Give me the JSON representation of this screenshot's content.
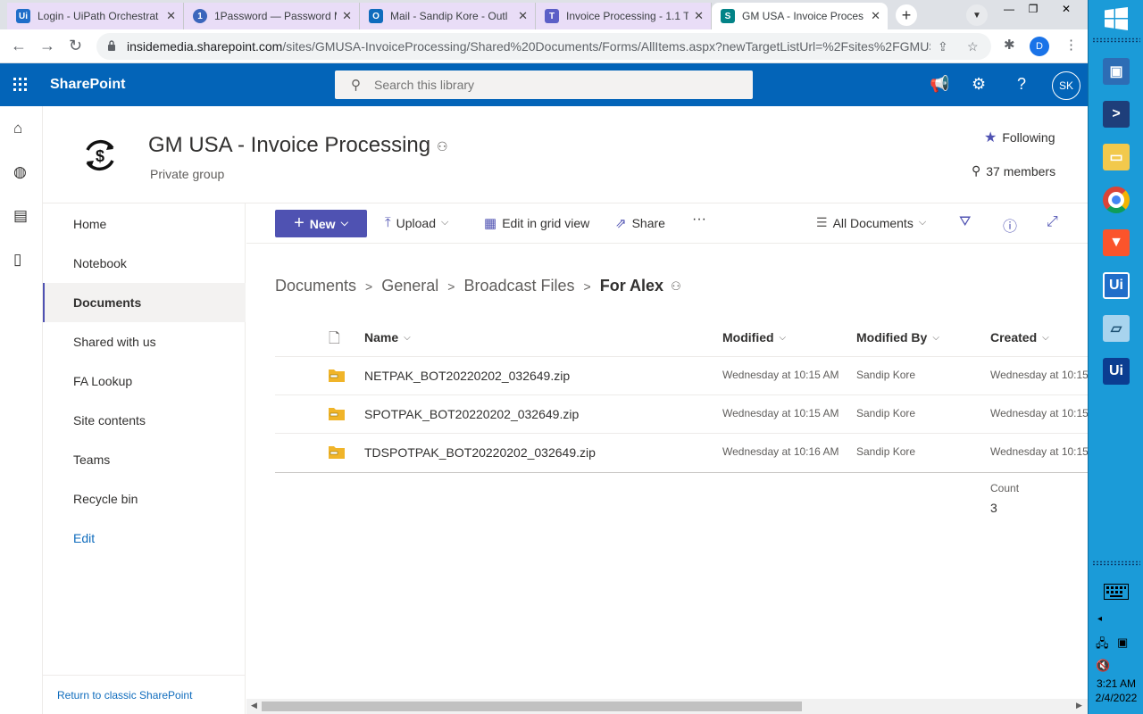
{
  "browser": {
    "tabs": [
      {
        "title": "Login - UiPath Orchestrat",
        "favicon": "Ui",
        "favicon_color": "#1f6ec9"
      },
      {
        "title": "1Password — Password M",
        "favicon": "1",
        "favicon_color": "#3b66bc"
      },
      {
        "title": "Mail - Sandip Kore - Outl",
        "favicon": "O",
        "favicon_color": "#0f6cbd"
      },
      {
        "title": "Invoice Processing - 1.1 T",
        "favicon": "T",
        "favicon_color": "#5b5fc7"
      },
      {
        "title": "GM USA - Invoice Proces",
        "favicon": "S",
        "favicon_color": "#038387"
      }
    ],
    "url_domain": "insidemedia.sharepoint.com",
    "url_rest": "/sites/GMUSA-InvoiceProcessing/Shared%20Documents/Forms/AllItems.aspx?newTargetListUrl=%2Fsites%2FGMUS...",
    "profile_initial": "D"
  },
  "suite": {
    "brand": "SharePoint",
    "search_placeholder": "Search this library",
    "avatar": "SK",
    "bar_color": "#0364b8"
  },
  "site": {
    "title": "GM USA - Invoice Processing",
    "privacy": "Private group",
    "following": "Following",
    "members": "37 members"
  },
  "nav": {
    "items": [
      "Home",
      "Notebook",
      "Documents",
      "Shared with us",
      "FA Lookup",
      "Site contents",
      "Teams",
      "Recycle bin"
    ],
    "selected": "Documents",
    "edit": "Edit",
    "classic": "Return to classic SharePoint"
  },
  "commands": {
    "new": "New",
    "upload": "Upload",
    "grid": "Edit in grid view",
    "share": "Share",
    "more": "···",
    "view": "All Documents",
    "accent": "#4f52b2"
  },
  "breadcrumb": [
    "Documents",
    "General",
    "Broadcast Files",
    "For Alex"
  ],
  "table": {
    "columns": [
      "Name",
      "Modified",
      "Modified By",
      "Created"
    ],
    "rows": [
      {
        "name": "NETPAK_BOT20220202_032649.zip",
        "modified": "Wednesday at 10:15 AM",
        "modified_by": "Sandip Kore",
        "created": "Wednesday at 10:15"
      },
      {
        "name": "SPOTPAK_BOT20220202_032649.zip",
        "modified": "Wednesday at 10:15 AM",
        "modified_by": "Sandip Kore",
        "created": "Wednesday at 10:15"
      },
      {
        "name": "TDSPOTPAK_BOT20220202_032649.zip",
        "modified": "Wednesday at 10:16 AM",
        "modified_by": "Sandip Kore",
        "created": "Wednesday at 10:15"
      }
    ],
    "count_label": "Count",
    "count_value": "3"
  },
  "taskbar": {
    "time": "3:21 AM",
    "date": "2/4/2022",
    "color": "#1b9bd8"
  }
}
